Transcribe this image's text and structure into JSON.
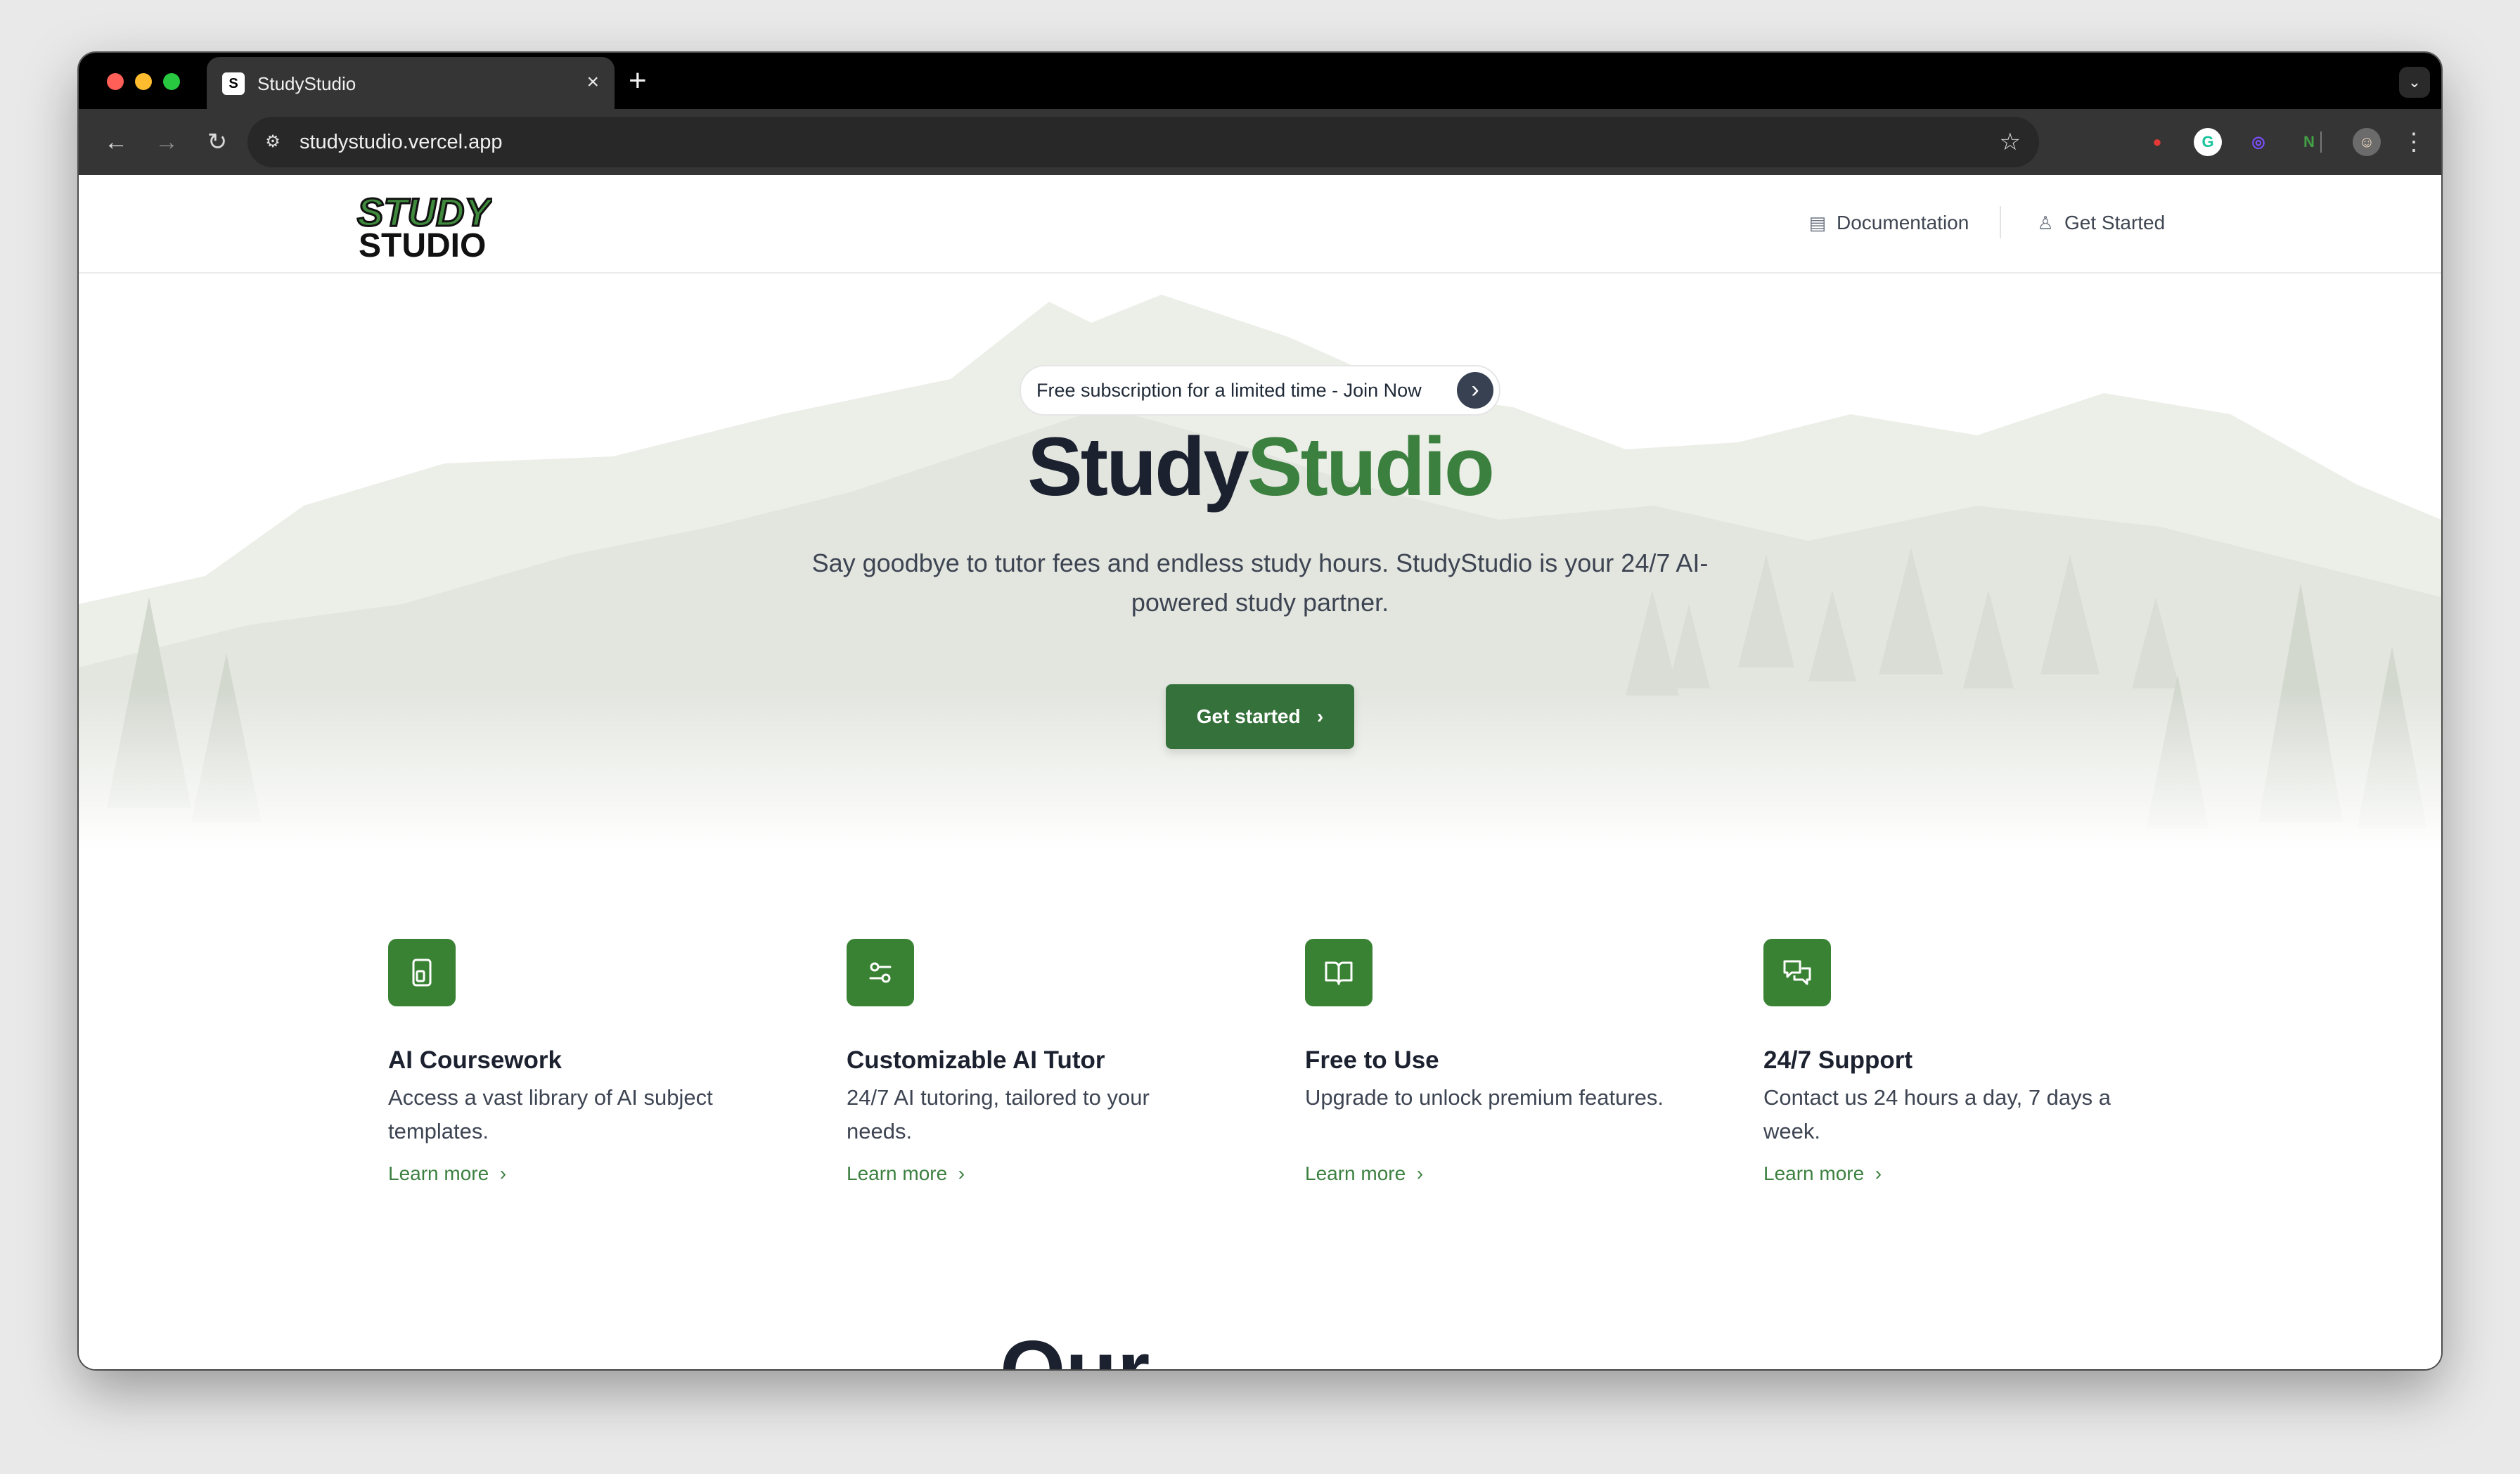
{
  "browser": {
    "tab_title": "StudyStudio",
    "tab_favicon_text": "S",
    "tab_close": "×",
    "new_tab": "+",
    "tab_menu": "⌄",
    "url": "studystudio.vercel.app",
    "nav": {
      "back": "←",
      "forward": "→",
      "reload": "↻",
      "star": "☆",
      "site_info": "⚙",
      "menu": "⋮"
    },
    "extensions": [
      {
        "name": "red-shield-extension-icon",
        "glyph": "●",
        "color": "#e53935"
      },
      {
        "name": "grammarly-extension-icon",
        "glyph": "G",
        "color": "#15c39a"
      },
      {
        "name": "colorful-ring-extension-icon",
        "glyph": "◎",
        "color": "#7c4dff"
      },
      {
        "name": "green-n-extension-icon",
        "glyph": "N",
        "color": "#43a047"
      },
      {
        "name": "puzzle-extension-icon",
        "glyph": "⧉",
        "color": "#dcdcdc"
      },
      {
        "name": "profile-avatar-icon",
        "glyph": "☺",
        "color": "#c9a27e"
      }
    ]
  },
  "site": {
    "logo": {
      "line1": "STUDY",
      "line2": "STUDIO"
    },
    "nav": {
      "documentation": "Documentation",
      "get_started": "Get Started"
    },
    "announcement": {
      "text": "Free subscription for a limited time - Join Now",
      "arrow": "›"
    },
    "hero": {
      "title_part1": "Study",
      "title_part2": "Studio",
      "subtitle": "Say goodbye to tutor fees and endless study hours. StudyStudio is your 24/7 AI-powered study partner.",
      "cta": "Get started",
      "cta_arrow": "›"
    },
    "features": [
      {
        "icon": "tablet-icon",
        "title": "AI Coursework",
        "desc": "Access a vast library of AI subject templates.",
        "link": "Learn more"
      },
      {
        "icon": "sliders-icon",
        "title": "Customizable AI Tutor",
        "desc": "24/7 AI tutoring, tailored to your needs.",
        "link": "Learn more"
      },
      {
        "icon": "book-open-icon",
        "title": "Free to Use",
        "desc": "Upgrade to unlock premium features.",
        "link": "Learn more"
      },
      {
        "icon": "chat-bubbles-icon",
        "title": "24/7 Support",
        "desc": "Contact us 24 hours a day, 7 days a week.",
        "link": "Learn more"
      }
    ],
    "link_arrow": "›",
    "next_section_heading": "Our Testimonials"
  },
  "colors": {
    "brand_green": "#3c8040",
    "button_green": "#35713a",
    "icon_green": "#398234",
    "heading_dark": "#1c2130"
  }
}
